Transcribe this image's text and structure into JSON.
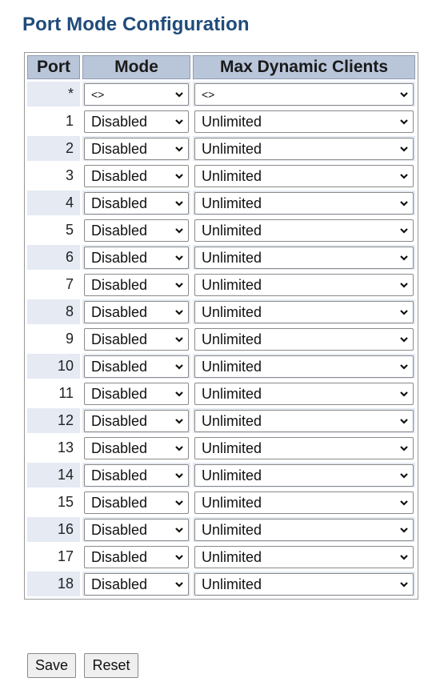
{
  "page": {
    "title": "Port Mode Configuration"
  },
  "table": {
    "headers": {
      "port": "Port",
      "mode": "Mode",
      "max_clients": "Max Dynamic Clients"
    },
    "wildcard": {
      "port": "*",
      "mode": "<>",
      "max_clients": "<>"
    },
    "rows": [
      {
        "port": "1",
        "mode": "Disabled",
        "max_clients": "Unlimited"
      },
      {
        "port": "2",
        "mode": "Disabled",
        "max_clients": "Unlimited"
      },
      {
        "port": "3",
        "mode": "Disabled",
        "max_clients": "Unlimited"
      },
      {
        "port": "4",
        "mode": "Disabled",
        "max_clients": "Unlimited"
      },
      {
        "port": "5",
        "mode": "Disabled",
        "max_clients": "Unlimited"
      },
      {
        "port": "6",
        "mode": "Disabled",
        "max_clients": "Unlimited"
      },
      {
        "port": "7",
        "mode": "Disabled",
        "max_clients": "Unlimited"
      },
      {
        "port": "8",
        "mode": "Disabled",
        "max_clients": "Unlimited"
      },
      {
        "port": "9",
        "mode": "Disabled",
        "max_clients": "Unlimited"
      },
      {
        "port": "10",
        "mode": "Disabled",
        "max_clients": "Unlimited"
      },
      {
        "port": "11",
        "mode": "Disabled",
        "max_clients": "Unlimited"
      },
      {
        "port": "12",
        "mode": "Disabled",
        "max_clients": "Unlimited"
      },
      {
        "port": "13",
        "mode": "Disabled",
        "max_clients": "Unlimited"
      },
      {
        "port": "14",
        "mode": "Disabled",
        "max_clients": "Unlimited"
      },
      {
        "port": "15",
        "mode": "Disabled",
        "max_clients": "Unlimited"
      },
      {
        "port": "16",
        "mode": "Disabled",
        "max_clients": "Unlimited"
      },
      {
        "port": "17",
        "mode": "Disabled",
        "max_clients": "Unlimited"
      },
      {
        "port": "18",
        "mode": "Disabled",
        "max_clients": "Unlimited"
      }
    ]
  },
  "buttons": {
    "save": "Save",
    "reset": "Reset"
  },
  "icons": {
    "dropdown": "chevron-down-icon"
  },
  "colors": {
    "title": "#1f4b7a",
    "header_bg": "#b9c6da",
    "row_alt_bg": "#e5eaf3"
  }
}
